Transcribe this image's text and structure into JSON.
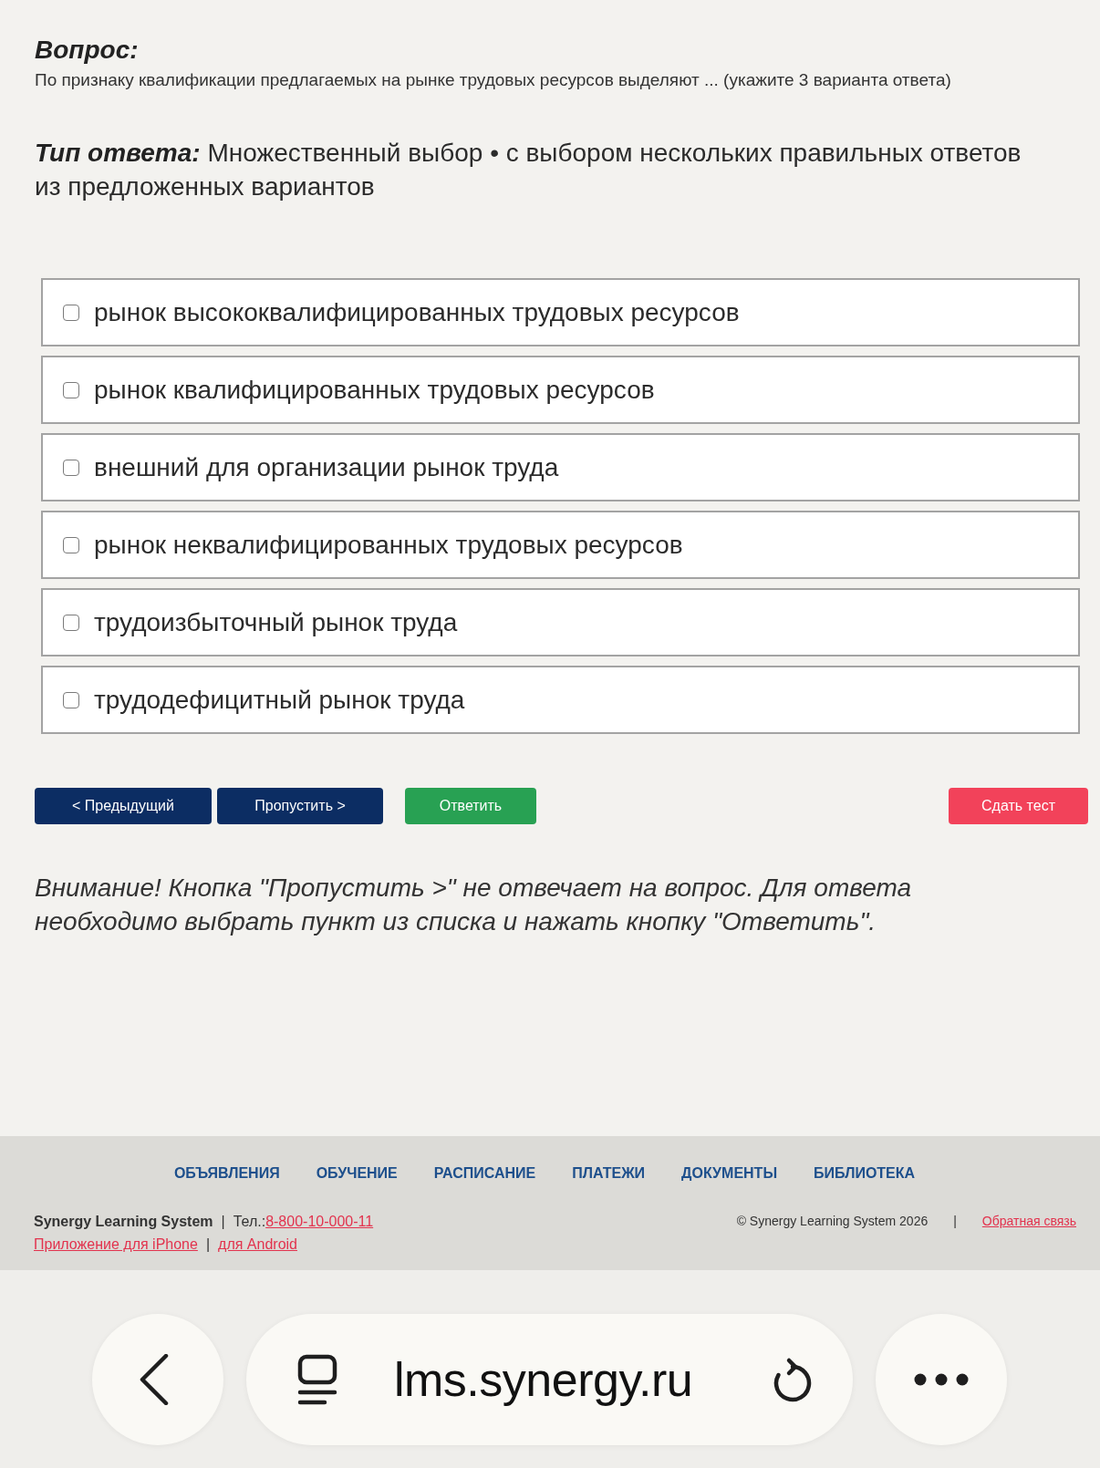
{
  "question": {
    "heading": "Вопрос:",
    "text": "По признаку квалификации предлагаемых на рынке трудовых ресурсов выделяют ... (укажите 3 варианта ответа)"
  },
  "answer_type": {
    "label": "Тип ответа:",
    "text": "Множественный выбор • с выбором нескольких правильных ответов из предложенных вариантов"
  },
  "options": [
    {
      "label": "рынок высококвалифицированных трудовых ресурсов",
      "checked": false
    },
    {
      "label": "рынок квалифицированных трудовых ресурсов",
      "checked": false
    },
    {
      "label": "внешний для организации рынок труда",
      "checked": false
    },
    {
      "label": "рынок неквалифицированных трудовых ресурсов",
      "checked": false
    },
    {
      "label": "трудоизбыточный рынок труда",
      "checked": false
    },
    {
      "label": "трудодефицитный рынок труда",
      "checked": false
    }
  ],
  "buttons": [
    {
      "label": "< Предыдущий",
      "kind": "nav"
    },
    {
      "label": "Пропустить >",
      "kind": "nav"
    },
    {
      "label": "Ответить",
      "kind": "answer"
    },
    {
      "label": "Сдать тест",
      "kind": "submit"
    }
  ],
  "notice": "Внимание! Кнопка \"Пропустить >\" не отвечает на вопрос. Для ответа необходимо выбрать пункт из списка и нажать кнопку \"Ответить\".",
  "footer": {
    "nav": [
      "ОБЪЯВЛЕНИЯ",
      "ОБУЧЕНИЕ",
      "РАСПИСАНИЕ",
      "ПЛАТЕЖИ",
      "ДОКУМЕНТЫ",
      "БИБЛИОТЕКА"
    ],
    "brand": "Synergy Learning System",
    "separator_1": "|",
    "phone_label": "Тел.:",
    "phone": "8-800-10-000-11",
    "iphone_link": "Приложение для iPhone",
    "separator_2": "|",
    "android_link": "для Android",
    "copyright": "© Synergy Learning System 2026",
    "separator_3": "|",
    "feedback_link": "Обратная связь"
  },
  "browser_bar": {
    "url": "lms.synergy.ru"
  }
}
